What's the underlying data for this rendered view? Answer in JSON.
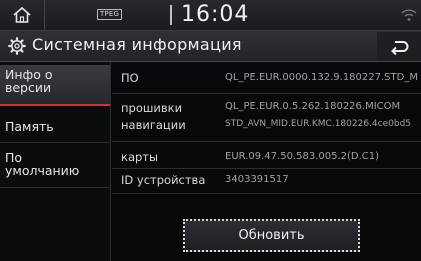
{
  "statusbar": {
    "tpeg": "TPEG",
    "time": "16:04"
  },
  "titlebar": {
    "title": "Системная информация"
  },
  "sidebar": {
    "items": [
      {
        "label": "Инфо о версии",
        "active": true
      },
      {
        "label": "Память",
        "active": false
      },
      {
        "label": "По умолчанию",
        "active": false
      }
    ]
  },
  "info": {
    "rows": [
      {
        "label": "ПО",
        "value": "QL_PE.EUR.0000.132.9.180227.STD_M"
      },
      {
        "label": "прошивки",
        "value": "QL_PE.EUR.0.5.262.180226.MICOM"
      },
      {
        "label": "навигации",
        "value": "STD_AVN_MID.EUR.KMC.180226.4ce0bd5"
      },
      {
        "label": "карты",
        "value": "EUR.09.47.50.583.005.2(D.C1)"
      },
      {
        "label": "ID устройства",
        "value": "3403391517"
      }
    ]
  },
  "actions": {
    "update_label": "Обновить"
  },
  "colors": {
    "accent": "#d2322f",
    "background": "#07080a"
  },
  "icons": {
    "home": "home-icon",
    "gear": "gear-icon",
    "back": "back-arrow-icon",
    "wifi": "wifi-icon"
  }
}
